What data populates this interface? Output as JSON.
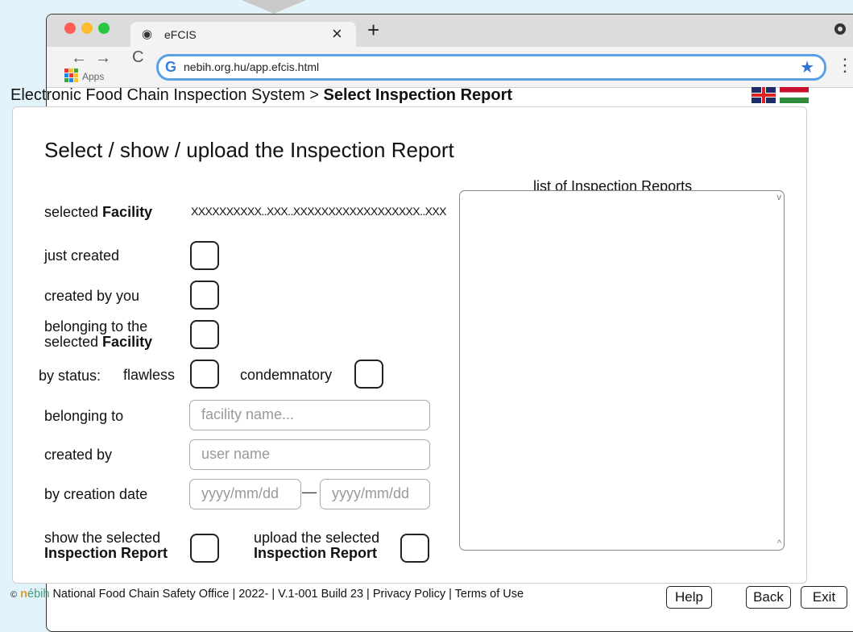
{
  "browser": {
    "tab_title": "eFCIS",
    "tab_close": "×",
    "new_tab": "+",
    "url": "nebih.org.hu/app.efcis.html",
    "apps_label": "Apps",
    "back_icon": "←",
    "forward_icon": "→",
    "reload_icon": "C",
    "google_icon": "G",
    "star_icon": "★",
    "menu_icon": "⋮"
  },
  "header": {
    "app_name": "Electronic Food Chain Inspection System",
    "separator": " > ",
    "page_name": "Select Inspection Report"
  },
  "form": {
    "heading": "Select / show / upload the Inspection Report",
    "selected_facility_label_pre": "selected ",
    "selected_facility_label_bold": "Facility",
    "selected_facility_value": "XXXXXXXXXX..XXX..XXXXXXXXXXXXXXXXXX..XXX",
    "just_created_label": "just created",
    "created_by_you_label": "created by you",
    "belonging_line1": "belonging to the",
    "belonging_line2_pre": "selected ",
    "belonging_line2_bold": "Facility",
    "status_label": "by status:",
    "flawless_label": "flawless",
    "condemnatory_label": "condemnatory",
    "belonging_to_label": "belonging to",
    "facility_placeholder": "facility name...",
    "created_by_label": "created by",
    "user_placeholder": "user name",
    "creation_date_label": "by creation date",
    "date_from_placeholder": "yyyy/mm/dd",
    "date_dash": "—",
    "date_to_placeholder": "yyyy/mm/dd",
    "show_line1": "show the selected",
    "show_line2": "Inspection Report",
    "upload_line1": "upload the selected",
    "upload_line2": "Inspection Report"
  },
  "list": {
    "title": "list of Inspection Reports",
    "scroll_up": "v",
    "scroll_down": "^"
  },
  "footer": {
    "copyright": "©",
    "logo_n": "n",
    "logo_rest": "ébih",
    "text": " National Food Chain Safety Office  |  2022-  |  V.1-001 Build 23  |  Privacy Policy  |  Terms of Use",
    "help": "Help",
    "back": "Back",
    "exit": "Exit"
  },
  "colors": {
    "page_bg": "#e3f3fb",
    "url_border": "#5aa0e6",
    "close_dot": "#ff5f57",
    "minimize_dot": "#febc2e",
    "zoom_dot": "#28c840"
  }
}
